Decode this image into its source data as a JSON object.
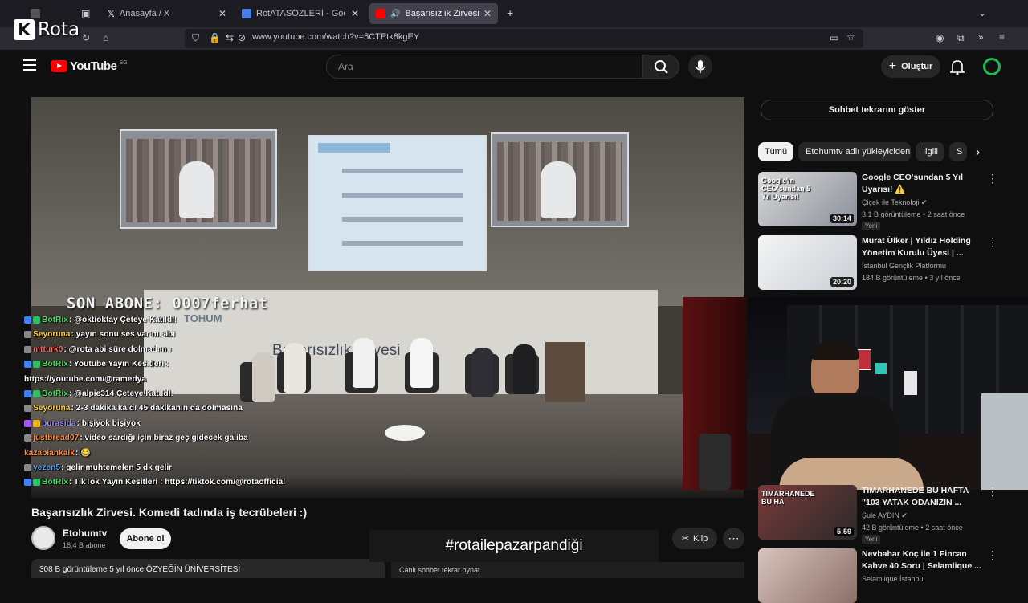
{
  "browser": {
    "tabs": [
      {
        "label": ""
      },
      {
        "label": "Anasayfa / X"
      },
      {
        "label": "RotATASÖZLERİ - Google Dokü"
      },
      {
        "label": "Başarısızlık Zirvesi. Komedi"
      }
    ],
    "new_tab": "+",
    "url": "www.youtube.com/watch?v=5CTEtk8kgEY"
  },
  "overlay": {
    "logo_letter": "K",
    "logo_text": "Rota",
    "son_abone": "SON ABONE: 0007ferhat",
    "hashtag": "#rotailepazarpandiği"
  },
  "youtube": {
    "logo_text": "YouTube",
    "logo_region": "SG",
    "search_placeholder": "Ara",
    "create_label": "Oluştur"
  },
  "chat": [
    {
      "user": "BotRix",
      "color": "#4cd964",
      "badges": [
        "#3b82f6",
        "#22c55e"
      ],
      "msg": ": @oktioktay Çeteye Katıldı!"
    },
    {
      "user": "Seyoruna",
      "color": "#ffd23f",
      "badges": [
        "#888"
      ],
      "msg": ": yayın sonu ses var mı abi"
    },
    {
      "user": "mtturk0",
      "color": "#ff6b6b",
      "badges": [
        "#888"
      ],
      "msg": ": @rota abi süre dolmadı mı"
    },
    {
      "user": "BotRix",
      "color": "#4cd964",
      "badges": [
        "#3b82f6",
        "#22c55e"
      ],
      "msg": ": Youtube Yayın Kesitleri :"
    },
    {
      "user": "",
      "color": "#ffffff",
      "badges": [],
      "msg": "https://youtube.com/@ramedya"
    },
    {
      "user": "BotRix",
      "color": "#4cd964",
      "badges": [
        "#3b82f6",
        "#22c55e"
      ],
      "msg": ": @alpie314 Çeteye Katıldı!"
    },
    {
      "user": "Seyoruna",
      "color": "#ffd23f",
      "badges": [
        "#888"
      ],
      "msg": ": 2-3 dakika kaldı 45 dakikanın da dolmasına"
    },
    {
      "user": "burasida",
      "color": "#a78bfa",
      "badges": [
        "#a855f7",
        "#eab308"
      ],
      "msg": ": bişiyok bişiyok"
    },
    {
      "user": "justbread07",
      "color": "#ff8c42",
      "badges": [
        "#888"
      ],
      "msg": ": video sardığı için biraz geç gidecek galiba"
    },
    {
      "user": "kazabiankalk",
      "color": "#ff8c42",
      "badges": [],
      "msg": ": 😂"
    },
    {
      "user": "yezen5",
      "color": "#60a5fa",
      "badges": [
        "#888"
      ],
      "msg": ": gelir muhtemelen 5 dk gelir"
    },
    {
      "user": "BotRix",
      "color": "#4cd964",
      "badges": [
        "#3b82f6",
        "#22c55e"
      ],
      "msg": ": TikTok Yayın Kesitleri : https://tiktok.com/@rotaofficial"
    }
  ],
  "video": {
    "title": "Başarısızlık Zirvesi. Komedi tadında iş tecrübeleri :)",
    "channel": "Etohumtv",
    "subscribers": "16,4 B abone",
    "subscribe_label": "Abone ol",
    "clip_label": "Klip",
    "more_label": "⋯",
    "description_meta": "308 B görüntüleme  5 yıl önce  ÖZYEĞİN ÜNİVERSİTESİ",
    "chat_replay_bottom": "Canlı sohbet tekrar oynat",
    "stage_text": "Başarısızlık Zirvesi",
    "stage_brand": "TOHUM"
  },
  "sidebar": {
    "chat_replay_label": "Sohbet tekrarını göster",
    "chips": [
      "Tümü",
      "Etohumtv adlı yükleyiciden",
      "İlgili",
      "S"
    ],
    "recs": [
      {
        "title": "Google CEO'sundan 5 Yıl Uyarısı! ⚠️",
        "channel": "Çiçek ile Teknoloji ✔",
        "meta": "3,1 B görüntüleme • 2 saat önce",
        "new": "Yeni",
        "duration": "30:14",
        "thumb_text": "Google'ın CEO'sundan 5 Yıl Uyarısı!"
      },
      {
        "title": "Murat Ülker | Yıldız Holding Yönetim Kurulu Üyesi | ...",
        "channel": "İstanbul Gençlik Platformu",
        "meta": "184 B görüntüleme • 3 yıl önce",
        "new": "",
        "duration": "20:20",
        "thumb_text": ""
      },
      {
        "title": "TIMARHANEDE BU HAFTA \"103 YATAK ODANIZIN ...",
        "channel": "Şule AYDIN ✔",
        "meta": "42 B görüntüleme • 2 saat önce",
        "new": "Yeni",
        "duration": "5:59",
        "thumb_text": "TIMARHANEDE BU HA"
      },
      {
        "title": "Nevbahar Koç ile 1 Fincan Kahve 40 Soru | Selamlique ...",
        "channel": "Selamlique İstanbul",
        "meta": "",
        "new": "",
        "duration": "",
        "thumb_text": ""
      }
    ]
  },
  "colors": {
    "yt_red": "#ff0000",
    "bg": "#0f0f0f",
    "chip_bg": "#272727"
  }
}
